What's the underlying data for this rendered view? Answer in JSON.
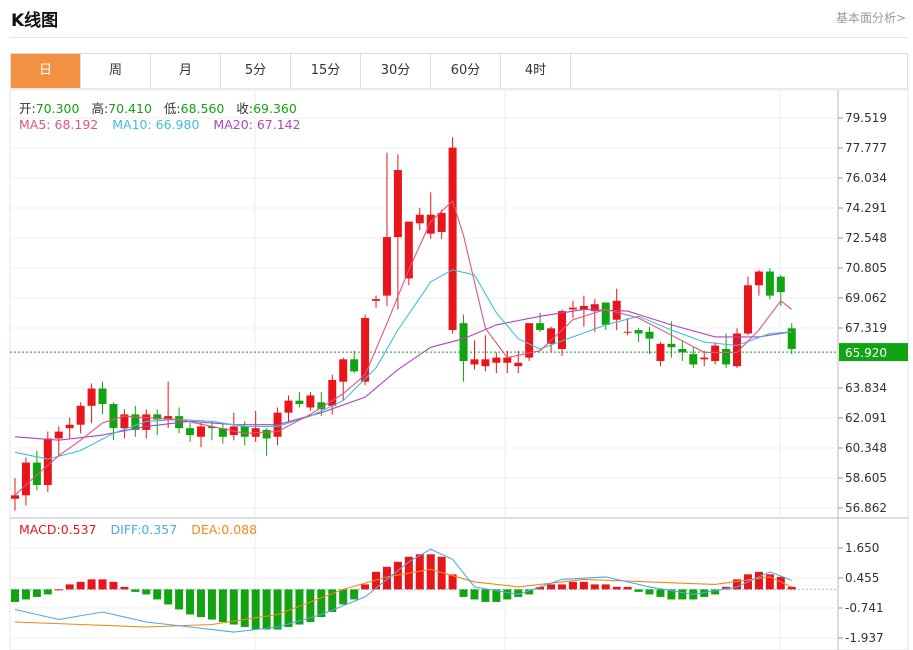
{
  "header": {
    "title": "K线图",
    "analysis_link": "基本面分析>"
  },
  "tabs": [
    "日",
    "周",
    "月",
    "5分",
    "15分",
    "30分",
    "60分",
    "4时"
  ],
  "active_tab": 0,
  "ohlc": {
    "open_label": "开:",
    "open": "70.300",
    "high_label": "高:",
    "high": "70.410",
    "low_label": "低:",
    "low": "68.560",
    "close_label": "收:",
    "close": "69.360"
  },
  "ma": {
    "ma5_label": "MA5:",
    "ma5": "68.192",
    "ma10_label": "MA10:",
    "ma10": "66.980",
    "ma20_label": "MA20:",
    "ma20": "67.142"
  },
  "macd_info": {
    "macd_label": "MACD:",
    "macd": "0.537",
    "diff_label": "DIFF:",
    "diff": "0.357",
    "dea_label": "DEA:",
    "dea": "0.088"
  },
  "colors": {
    "up": "#e8161b",
    "down": "#12a312",
    "ma5": "#e0567f",
    "ma10": "#3fbfdc",
    "ma20": "#b144c3",
    "diff": "#4fa9e0",
    "dea": "#f0871c",
    "price_tag": "#12a312",
    "tab_active": "#f39142"
  },
  "chart_data": {
    "type": "candlestick",
    "price_ticks": [
      "79.519",
      "77.777",
      "76.034",
      "74.291",
      "72.548",
      "70.805",
      "69.062",
      "67.319",
      "65.920",
      "63.834",
      "62.091",
      "60.348",
      "58.605",
      "56.862"
    ],
    "last_price": "65.920",
    "macd_ticks": [
      "1.650",
      "0.455",
      "-0.741",
      "-1.937"
    ],
    "candles": [
      [
        57.4,
        58.6,
        56.7,
        57.6
      ],
      [
        57.6,
        59.8,
        57.0,
        59.5
      ],
      [
        59.5,
        60.2,
        57.9,
        58.2
      ],
      [
        58.2,
        61.3,
        57.8,
        60.9
      ],
      [
        60.9,
        61.6,
        59.9,
        61.3
      ],
      [
        61.5,
        62.1,
        60.9,
        61.7
      ],
      [
        61.7,
        63.0,
        61.2,
        62.8
      ],
      [
        62.8,
        64.1,
        61.8,
        63.8
      ],
      [
        63.8,
        64.2,
        62.3,
        62.9
      ],
      [
        62.9,
        63.0,
        60.8,
        61.5
      ],
      [
        61.5,
        62.6,
        60.9,
        62.3
      ],
      [
        62.3,
        62.8,
        61.0,
        61.4
      ],
      [
        61.4,
        62.6,
        60.9,
        62.3
      ],
      [
        62.3,
        62.6,
        61.1,
        62.0
      ],
      [
        62.0,
        64.2,
        61.5,
        62.2
      ],
      [
        62.2,
        62.7,
        61.2,
        61.5
      ],
      [
        61.5,
        61.8,
        60.7,
        61.1
      ],
      [
        61.0,
        61.8,
        60.4,
        61.6
      ],
      [
        61.6,
        61.9,
        60.8,
        61.5
      ],
      [
        61.5,
        61.8,
        60.6,
        61.0
      ],
      [
        61.1,
        62.4,
        60.8,
        61.6
      ],
      [
        61.6,
        61.9,
        60.5,
        61.0
      ],
      [
        61.0,
        62.5,
        60.7,
        61.5
      ],
      [
        61.4,
        61.5,
        59.9,
        60.9
      ],
      [
        61.0,
        62.7,
        60.5,
        62.4
      ],
      [
        62.4,
        63.4,
        61.9,
        63.1
      ],
      [
        63.1,
        63.6,
        62.7,
        62.9
      ],
      [
        62.7,
        63.6,
        62.5,
        63.4
      ],
      [
        63.0,
        63.6,
        62.2,
        62.6
      ],
      [
        62.8,
        64.6,
        62.3,
        64.3
      ],
      [
        64.2,
        65.6,
        63.1,
        65.5
      ],
      [
        65.5,
        66.0,
        64.7,
        64.8
      ],
      [
        64.2,
        68.1,
        64.0,
        67.9
      ],
      [
        68.9,
        69.2,
        68.5,
        69.0
      ],
      [
        69.2,
        77.5,
        68.6,
        72.6
      ],
      [
        72.6,
        77.4,
        68.4,
        76.5
      ],
      [
        70.2,
        73.5,
        69.8,
        73.5
      ],
      [
        73.4,
        74.3,
        73.0,
        73.9
      ],
      [
        72.8,
        75.2,
        72.5,
        73.9
      ],
      [
        72.9,
        74.2,
        72.5,
        74.0
      ],
      [
        67.2,
        78.4,
        67.0,
        77.8
      ],
      [
        67.6,
        68.1,
        64.2,
        65.4
      ],
      [
        65.2,
        66.6,
        64.9,
        65.5
      ],
      [
        65.1,
        66.9,
        64.8,
        65.5
      ],
      [
        65.3,
        65.9,
        64.7,
        65.6
      ],
      [
        65.3,
        66.0,
        64.7,
        65.6
      ],
      [
        65.1,
        66.0,
        64.7,
        65.3
      ],
      [
        65.6,
        67.6,
        65.4,
        67.6
      ],
      [
        67.6,
        68.2,
        67.1,
        67.2
      ],
      [
        66.4,
        67.4,
        65.9,
        67.3
      ],
      [
        66.1,
        68.4,
        65.7,
        68.3
      ],
      [
        68.4,
        68.9,
        67.9,
        68.5
      ],
      [
        68.4,
        69.2,
        67.4,
        68.6
      ],
      [
        68.3,
        69.0,
        67.1,
        68.7
      ],
      [
        68.8,
        68.8,
        67.2,
        67.5
      ],
      [
        67.8,
        69.6,
        67.2,
        68.9
      ],
      [
        67.1,
        67.9,
        66.9,
        67.1
      ],
      [
        67.2,
        67.3,
        66.5,
        67.0
      ],
      [
        67.1,
        67.4,
        65.8,
        66.7
      ],
      [
        65.4,
        66.5,
        65.1,
        66.4
      ],
      [
        66.4,
        67.7,
        65.6,
        66.2
      ],
      [
        66.1,
        66.6,
        65.4,
        65.9
      ],
      [
        65.8,
        66.2,
        65.0,
        65.2
      ],
      [
        65.5,
        66.0,
        65.1,
        65.6
      ],
      [
        65.4,
        66.5,
        65.2,
        66.3
      ],
      [
        66.1,
        67.0,
        65.0,
        65.2
      ],
      [
        65.1,
        67.3,
        65.0,
        67.0
      ],
      [
        67.0,
        70.3,
        66.9,
        69.8
      ],
      [
        69.8,
        70.7,
        69.2,
        70.6
      ],
      [
        70.6,
        70.8,
        69.0,
        69.2
      ],
      [
        70.3,
        70.4,
        68.6,
        69.4
      ],
      [
        67.3,
        67.6,
        65.8,
        66.1
      ]
    ],
    "ma5": [
      [
        0,
        57.6
      ],
      [
        2,
        58.8
      ],
      [
        4,
        59.9
      ],
      [
        6,
        60.8
      ],
      [
        8,
        61.8
      ],
      [
        10,
        62.2
      ],
      [
        12,
        62.1
      ],
      [
        15,
        62.0
      ],
      [
        18,
        61.6
      ],
      [
        21,
        61.2
      ],
      [
        24,
        61.3
      ],
      [
        27,
        62.3
      ],
      [
        30,
        63.5
      ],
      [
        32,
        64.6
      ],
      [
        34,
        67.6
      ],
      [
        36,
        70.7
      ],
      [
        38,
        73.5
      ],
      [
        40,
        74.7
      ],
      [
        41,
        72.7
      ],
      [
        43,
        67.3
      ],
      [
        45,
        65.6
      ],
      [
        48,
        66.0
      ],
      [
        51,
        67.8
      ],
      [
        54,
        68.4
      ],
      [
        57,
        67.9
      ],
      [
        60,
        66.9
      ],
      [
        63,
        65.9
      ],
      [
        66,
        65.9
      ],
      [
        68,
        67.2
      ],
      [
        70,
        68.9
      ],
      [
        71,
        68.4
      ]
    ],
    "ma10": [
      [
        0,
        60.1
      ],
      [
        3,
        59.7
      ],
      [
        6,
        60.2
      ],
      [
        9,
        61.2
      ],
      [
        12,
        61.9
      ],
      [
        15,
        62.0
      ],
      [
        18,
        61.9
      ],
      [
        21,
        61.6
      ],
      [
        24,
        61.6
      ],
      [
        27,
        62.2
      ],
      [
        30,
        63.1
      ],
      [
        33,
        65.0
      ],
      [
        35,
        67.2
      ],
      [
        38,
        70.0
      ],
      [
        40,
        70.7
      ],
      [
        42,
        70.4
      ],
      [
        44,
        68.2
      ],
      [
        46,
        66.7
      ],
      [
        48,
        66.1
      ],
      [
        51,
        66.8
      ],
      [
        54,
        67.5
      ],
      [
        57,
        68.0
      ],
      [
        60,
        67.2
      ],
      [
        63,
        66.5
      ],
      [
        66,
        66.3
      ],
      [
        69,
        67.0
      ],
      [
        71,
        67.1
      ]
    ],
    "ma20": [
      [
        0,
        61.0
      ],
      [
        4,
        60.8
      ],
      [
        8,
        61.1
      ],
      [
        12,
        61.6
      ],
      [
        16,
        61.9
      ],
      [
        20,
        61.7
      ],
      [
        24,
        61.7
      ],
      [
        28,
        62.4
      ],
      [
        32,
        63.3
      ],
      [
        35,
        64.9
      ],
      [
        38,
        66.2
      ],
      [
        41,
        66.7
      ],
      [
        44,
        67.5
      ],
      [
        48,
        68.0
      ],
      [
        52,
        68.4
      ],
      [
        56,
        68.3
      ],
      [
        60,
        67.5
      ],
      [
        64,
        66.8
      ],
      [
        68,
        66.8
      ],
      [
        71,
        67.1
      ]
    ],
    "macd_hist": [
      -0.5,
      -0.4,
      -0.3,
      -0.2,
      0.0,
      0.2,
      0.3,
      0.4,
      0.4,
      0.3,
      0.1,
      -0.1,
      -0.2,
      -0.4,
      -0.6,
      -0.8,
      -1.0,
      -1.1,
      -1.2,
      -1.3,
      -1.4,
      -1.5,
      -1.6,
      -1.6,
      -1.6,
      -1.5,
      -1.4,
      -1.3,
      -1.1,
      -0.9,
      -0.6,
      -0.4,
      0.2,
      0.7,
      0.9,
      1.1,
      1.3,
      1.4,
      1.4,
      1.3,
      0.6,
      -0.3,
      -0.4,
      -0.5,
      -0.5,
      -0.4,
      -0.3,
      -0.2,
      0.1,
      0.2,
      0.2,
      0.3,
      0.3,
      0.2,
      0.2,
      0.1,
      0.1,
      -0.1,
      -0.2,
      -0.3,
      -0.4,
      -0.4,
      -0.4,
      -0.3,
      -0.2,
      0.1,
      0.4,
      0.6,
      0.7,
      0.6,
      0.5,
      0.1
    ],
    "diff": [
      [
        0,
        -0.8
      ],
      [
        4,
        -1.2
      ],
      [
        8,
        -0.9
      ],
      [
        12,
        -1.3
      ],
      [
        16,
        -1.5
      ],
      [
        20,
        -1.7
      ],
      [
        24,
        -1.5
      ],
      [
        28,
        -1.0
      ],
      [
        32,
        -0.3
      ],
      [
        36,
        1.1
      ],
      [
        38,
        1.6
      ],
      [
        40,
        1.2
      ],
      [
        42,
        0.1
      ],
      [
        46,
        -0.2
      ],
      [
        50,
        0.4
      ],
      [
        54,
        0.5
      ],
      [
        58,
        0.1
      ],
      [
        62,
        -0.2
      ],
      [
        66,
        0.1
      ],
      [
        69,
        0.7
      ],
      [
        71,
        0.36
      ]
    ],
    "dea": [
      [
        0,
        -1.3
      ],
      [
        6,
        -1.4
      ],
      [
        12,
        -1.5
      ],
      [
        18,
        -1.4
      ],
      [
        24,
        -1.0
      ],
      [
        30,
        0.0
      ],
      [
        34,
        0.5
      ],
      [
        38,
        0.8
      ],
      [
        42,
        0.3
      ],
      [
        46,
        0.1
      ],
      [
        52,
        0.4
      ],
      [
        58,
        0.3
      ],
      [
        64,
        0.2
      ],
      [
        69,
        0.5
      ],
      [
        71,
        0.09
      ]
    ]
  }
}
